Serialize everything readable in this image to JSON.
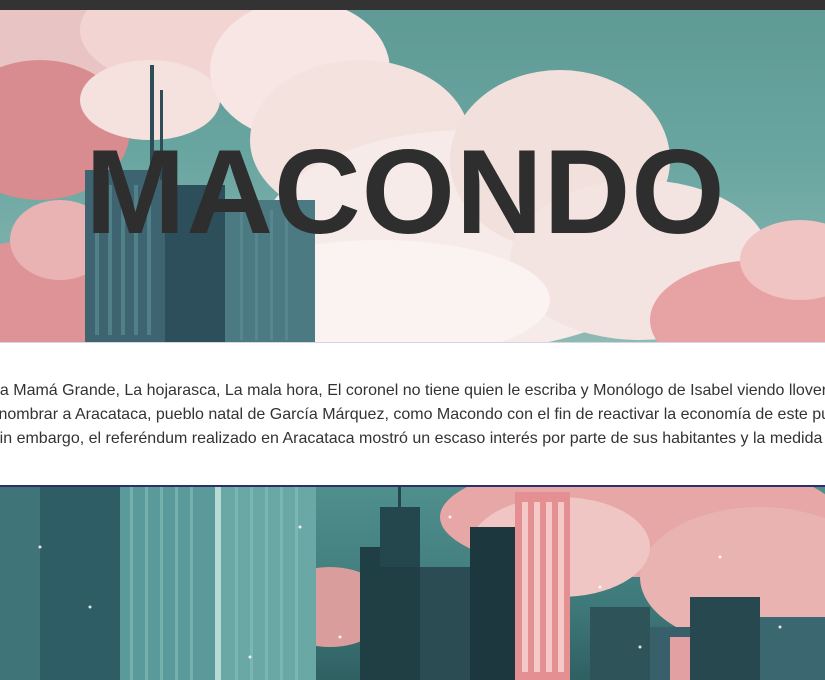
{
  "hero": {
    "title": "MACONDO"
  },
  "text_band": {
    "lines": [
      "La Mamá Grande, La hojarasca, La mala hora, El coronel no tiene quien le escriba y Monólogo de Isabel viendo llover en Macondo",
      "Renombrar a Aracataca, pueblo natal de García Márquez, como Macondo con el fin de reactivar la economía de este pueblo",
      "Sin embargo, el referéndum realizado en Aracataca mostró un escaso interés por parte de sus habitantes y la medida no fue aprobada"
    ]
  },
  "colors": {
    "top_bar": "#333333",
    "title": "#2e2e2e",
    "band_background": "#ffffff",
    "band_text": "#333333",
    "band_border": "#2b2f6b"
  }
}
